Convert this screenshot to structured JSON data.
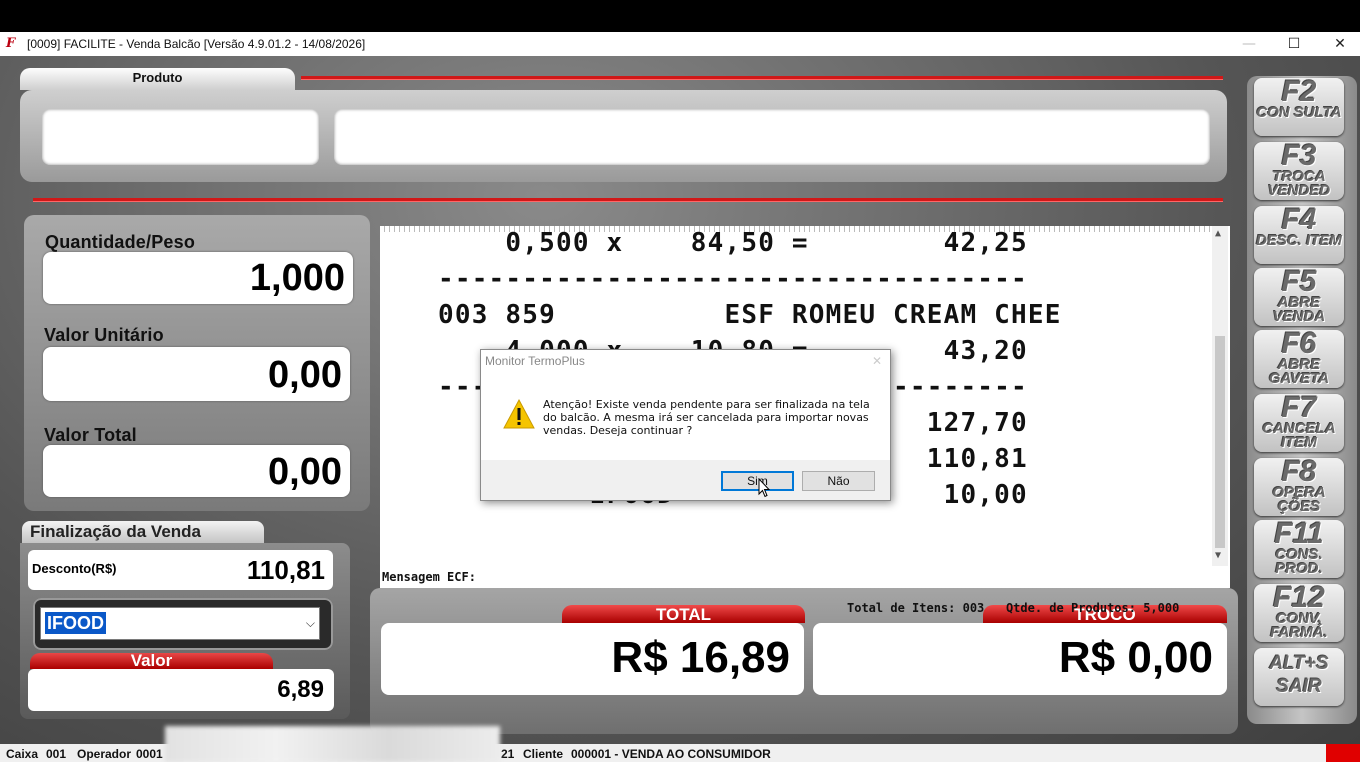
{
  "window": {
    "title": "[0009] FACILITE - Venda Balcão [Versão 4.9.01.2 - 14/08/2026]",
    "minimize": "—",
    "maximize": "☐",
    "close": "✕"
  },
  "produto": {
    "tab_label": "Produto",
    "code_value": "",
    "description_value": ""
  },
  "quantidade": {
    "label": "Quantidade/Peso",
    "value": "1,000"
  },
  "valor_unitario": {
    "label": "Valor Unitário",
    "value": "0,00"
  },
  "valor_total": {
    "label": "Valor Total",
    "value": "0,00"
  },
  "finalizacao": {
    "title": "Finalização da Venda",
    "desconto_label": "Desconto(R$)",
    "desconto_value": "110,81",
    "payment_method": "IFOOD",
    "valor_label": "Valor",
    "valor_value": "6,89"
  },
  "receipt": {
    "lines": [
      "    0,500 x    84,50 =        42,25",
      "-----------------------------------",
      "003 859          ESF ROMEU CREAM CHEE",
      "    4,000 x    10,80 =        43,20",
      "-----------------------------------",
      "                     =       127,70",
      "                     =       110,81",
      "         IFOOD       =        10,00"
    ],
    "mensagem_label": "Mensagem ECF:"
  },
  "totals": {
    "total_label": "TOTAL",
    "total_value": "R$ 16,89",
    "troco_label": "TROCO",
    "troco_value": "R$ 0,00",
    "items_info": "Total de Itens: 003   Qtde. de Produtos: 5,000"
  },
  "function_keys": [
    {
      "key": "F2",
      "text": "CON SULTA"
    },
    {
      "key": "F3",
      "text": "TROCA VENDED"
    },
    {
      "key": "F4",
      "text": "DESC. ITEM"
    },
    {
      "key": "F5",
      "text": "ABRE VENDA"
    },
    {
      "key": "F6",
      "text": "ABRE GAVETA"
    },
    {
      "key": "F7",
      "text": "CANCELA ITEM"
    },
    {
      "key": "F8",
      "text": "OPERA ÇÕES"
    },
    {
      "key": "F11",
      "text": "CONS. PROD."
    },
    {
      "key": "F12",
      "text": "CONV. FARMÁ."
    },
    {
      "key": "ALT+S",
      "text": "SAIR"
    }
  ],
  "statusbar": {
    "caixa_label": "Caixa",
    "caixa_value": "001",
    "operador_label": "Operador",
    "operador_value": "0001",
    "partial": "21",
    "cliente_label": "Cliente",
    "cliente_value": "000001 - VENDA AO CONSUMIDOR",
    "indicator_color": "#e00000"
  },
  "dialog": {
    "title": "Monitor TermoPlus",
    "message": "Atenção! Existe venda pendente para ser finalizada na tela do balcão. A mesma irá ser cancelada para importar novas vendas. Deseja continuar ?",
    "yes_label": "Sim",
    "no_label": "Não",
    "icon": "warning-icon"
  }
}
